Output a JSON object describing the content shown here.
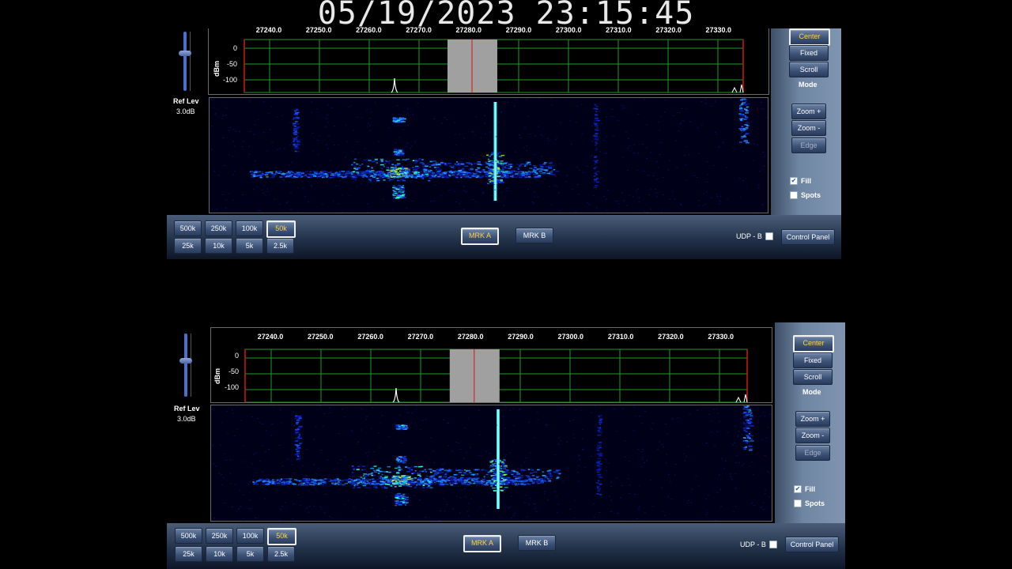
{
  "timestamp": "05/19/2023 23:15:45",
  "top_panel": {
    "freq_ticks": [
      "27240.0",
      "27250.0",
      "27260.0",
      "27270.0",
      "27280.0",
      "27290.0",
      "27300.0",
      "27310.0",
      "27320.0",
      "27330.0"
    ],
    "dbm_axis": "dBm",
    "dbm_ticks": [
      "0",
      "-50",
      "-100"
    ],
    "ref_lev_label": "Ref Lev",
    "ref_lev_value": "3.0dB",
    "mode_buttons": [
      "Center",
      "Fixed",
      "Scroll"
    ],
    "mode_selected": "Center",
    "mode_label": "Mode",
    "zoom_in": "Zoom +",
    "zoom_out": "Zoom -",
    "edge": "Edge",
    "fill_label": "Fill",
    "fill_checked": true,
    "spots_label": "Spots",
    "spots_checked": false,
    "span_buttons": [
      "500k",
      "250k",
      "100k",
      "50k",
      "25k",
      "10k",
      "5k",
      "2.5k"
    ],
    "span_selected": "50k",
    "marker_a": "MRK A",
    "marker_b": "MRK B",
    "udp_label": "UDP - B",
    "control_panel": "Control Panel"
  },
  "bottom_panel": {
    "freq_ticks": [
      "27240.0",
      "27250.0",
      "27260.0",
      "27270.0",
      "27280.0",
      "27290.0",
      "27300.0",
      "27310.0",
      "27320.0",
      "27330.0"
    ],
    "dbm_axis": "dBm",
    "dbm_ticks": [
      "0",
      "-50",
      "-100"
    ],
    "ref_lev_label": "Ref Lev",
    "ref_lev_value": "3.0dB",
    "mode_buttons": [
      "Center",
      "Fixed",
      "Scroll"
    ],
    "mode_selected": "Center",
    "mode_label": "Mode",
    "zoom_in": "Zoom +",
    "zoom_out": "Zoom -",
    "edge": "Edge",
    "fill_label": "Fill",
    "fill_checked": true,
    "spots_label": "Spots",
    "spots_checked": false,
    "span_buttons": [
      "500k",
      "250k",
      "100k",
      "50k",
      "25k",
      "10k",
      "5k",
      "2.5k"
    ],
    "span_selected": "50k",
    "marker_a": "MRK A",
    "marker_b": "MRK B",
    "udp_label": "UDP - B",
    "control_panel": "Control Panel"
  },
  "colors": {
    "grid_green": "#1f9a2a",
    "marker_red": "#d01818",
    "selected_text": "#ffd24a",
    "slider_blue": "#4a6fd0"
  }
}
